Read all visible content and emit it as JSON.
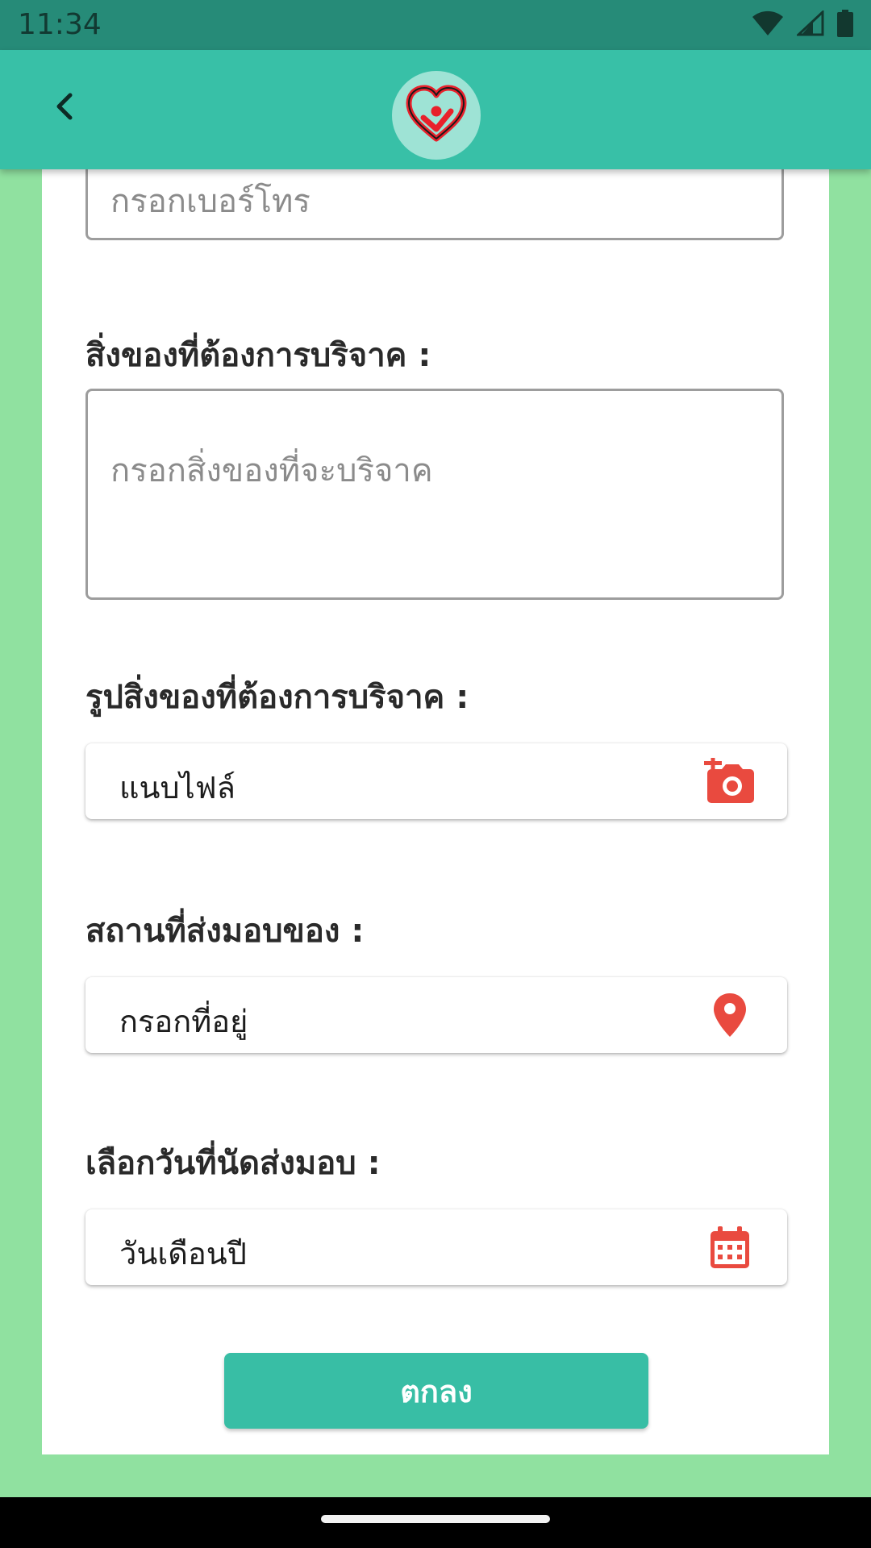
{
  "status_bar": {
    "time": "11:34",
    "icons": [
      "wifi-icon",
      "signal-icon",
      "battery-icon"
    ]
  },
  "app_bar": {
    "back_icon": "chevron-left-icon",
    "logo_icon": "heart-logo-icon"
  },
  "form": {
    "phone": {
      "placeholder": "กรอกเบอร์โทร"
    },
    "donation_items": {
      "label": "สิ่งของที่ต้องการบริจาค :",
      "placeholder": "กรอกสิ่งของที่จะบริจาค"
    },
    "photo": {
      "label": "รูปสิ่งของที่ต้องการบริจาค :",
      "value": "แนบไฟล์",
      "icon": "add-photo-icon"
    },
    "location": {
      "label": "สถานที่ส่งมอบของ :",
      "value": "กรอกที่อยู่",
      "icon": "map-pin-icon"
    },
    "date": {
      "label": "เลือกวันที่นัดส่งมอบ :",
      "value": "วันเดือนปี",
      "icon": "calendar-icon"
    },
    "submit_label": "ตกลง"
  },
  "colors": {
    "status_bar": "#268b78",
    "app_bar": "#38c0a7",
    "page_background": "#90e1a0",
    "accent_red": "#e94a3f",
    "button": "#38bea5"
  }
}
